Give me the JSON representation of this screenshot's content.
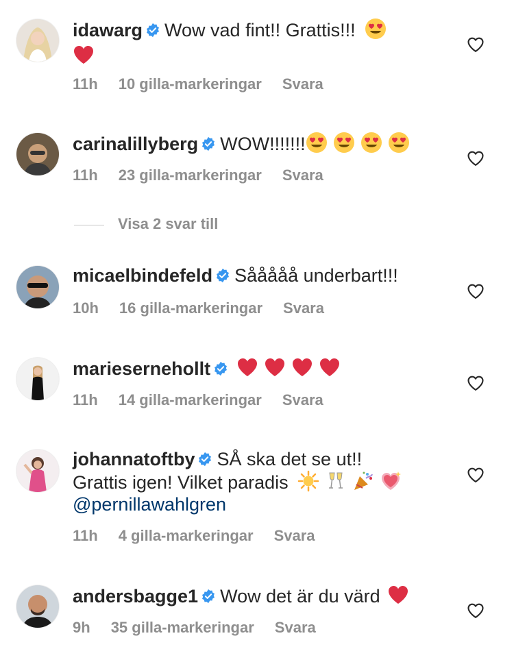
{
  "comments": [
    {
      "username": "idawarg",
      "text_before": "Wow vad fint!! Grattis!!!",
      "emojis": [
        "heart-eyes",
        "red-heart"
      ],
      "time": "11h",
      "likes": "10 gilla-markeringar",
      "reply": "Svara"
    },
    {
      "username": "carinalillyberg",
      "text_before": "WOW!!!!!!!",
      "emojis": [
        "heart-eyes",
        "heart-eyes",
        "heart-eyes",
        "heart-eyes"
      ],
      "time": "11h",
      "likes": "23 gilla-markeringar",
      "reply": "Svara",
      "view_replies": "Visa 2 svar till"
    },
    {
      "username": "micaelbindefeld",
      "text_before": "Sååååå underbart!!!",
      "emojis": [],
      "time": "10h",
      "likes": "16 gilla-markeringar",
      "reply": "Svara"
    },
    {
      "username": "mariesernehollt",
      "text_before": "",
      "emojis": [
        "red-heart",
        "red-heart",
        "red-heart",
        "red-heart"
      ],
      "time": "11h",
      "likes": "14 gilla-markeringar",
      "reply": "Svara"
    },
    {
      "username": "johannatoftby",
      "text_before": "SÅ ska det se ut!!",
      "text_line2": "Grattis igen! Vilket paradis",
      "emojis": [
        "sun",
        "champagne-glasses",
        "party-popper",
        "sparkling-heart"
      ],
      "mention": "@pernillawahlgren",
      "time": "11h",
      "likes": "4 gilla-markeringar",
      "reply": "Svara"
    },
    {
      "username": "andersbagge1",
      "text_before": "Wow det är du värd",
      "emojis": [
        "red-heart"
      ],
      "time": "9h",
      "likes": "35 gilla-markeringar",
      "reply": "Svara"
    }
  ],
  "icons": {
    "verified": "verified-badge-icon",
    "like": "heart-outline-icon"
  },
  "colors": {
    "verified": "#3897f0",
    "meta": "#8e8e8e",
    "mention": "#00376b",
    "text": "#262626"
  }
}
